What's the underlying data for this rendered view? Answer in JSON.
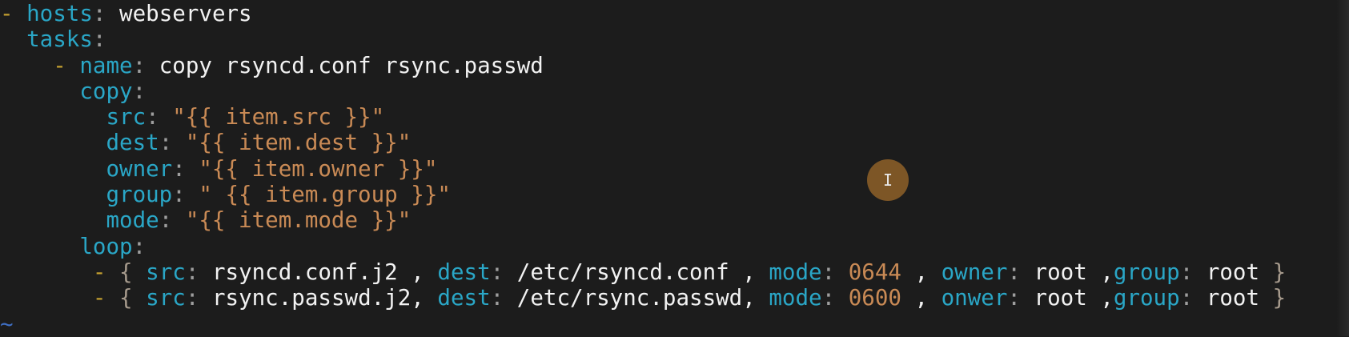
{
  "editor": {
    "lines": [
      [
        {
          "t": "- ",
          "c": "dash"
        },
        {
          "t": "hosts",
          "c": "key"
        },
        {
          "t": ": ",
          "c": "colon"
        },
        {
          "t": "webservers",
          "c": "plain"
        }
      ],
      [
        {
          "t": "  ",
          "c": "plain"
        },
        {
          "t": "tasks",
          "c": "key"
        },
        {
          "t": ":",
          "c": "colon"
        }
      ],
      [
        {
          "t": "    ",
          "c": "plain"
        },
        {
          "t": "- ",
          "c": "dash"
        },
        {
          "t": "name",
          "c": "key"
        },
        {
          "t": ": ",
          "c": "colon"
        },
        {
          "t": "copy rsyncd.conf rsync.passwd",
          "c": "plain"
        }
      ],
      [
        {
          "t": "      ",
          "c": "plain"
        },
        {
          "t": "copy",
          "c": "key"
        },
        {
          "t": ":",
          "c": "colon"
        }
      ],
      [
        {
          "t": "        ",
          "c": "plain"
        },
        {
          "t": "src",
          "c": "key"
        },
        {
          "t": ": ",
          "c": "colon"
        },
        {
          "t": "\"{{ item.src }}\"",
          "c": "str"
        }
      ],
      [
        {
          "t": "        ",
          "c": "plain"
        },
        {
          "t": "dest",
          "c": "key"
        },
        {
          "t": ": ",
          "c": "colon"
        },
        {
          "t": "\"{{ item.dest }}\"",
          "c": "str"
        }
      ],
      [
        {
          "t": "        ",
          "c": "plain"
        },
        {
          "t": "owner",
          "c": "key"
        },
        {
          "t": ": ",
          "c": "colon"
        },
        {
          "t": "\"{{ item.owner }}\"",
          "c": "str"
        }
      ],
      [
        {
          "t": "        ",
          "c": "plain"
        },
        {
          "t": "group",
          "c": "key"
        },
        {
          "t": ": ",
          "c": "colon"
        },
        {
          "t": "\" {{ item.group }}\"",
          "c": "str"
        }
      ],
      [
        {
          "t": "        ",
          "c": "plain"
        },
        {
          "t": "mode",
          "c": "key"
        },
        {
          "t": ": ",
          "c": "colon"
        },
        {
          "t": "\"{{ item.mode }}\"",
          "c": "str"
        }
      ],
      [
        {
          "t": "      ",
          "c": "plain"
        },
        {
          "t": "loop",
          "c": "key"
        },
        {
          "t": ":",
          "c": "colon"
        }
      ],
      [
        {
          "t": "       ",
          "c": "plain"
        },
        {
          "t": "- ",
          "c": "dash"
        },
        {
          "t": "{ ",
          "c": "brace"
        },
        {
          "t": "src",
          "c": "key"
        },
        {
          "t": ": ",
          "c": "colon"
        },
        {
          "t": "rsyncd.conf.j2 , ",
          "c": "plain"
        },
        {
          "t": "dest",
          "c": "key"
        },
        {
          "t": ": ",
          "c": "colon"
        },
        {
          "t": "/etc/rsyncd.conf , ",
          "c": "plain"
        },
        {
          "t": "mode",
          "c": "key"
        },
        {
          "t": ": ",
          "c": "colon"
        },
        {
          "t": "0644",
          "c": "num"
        },
        {
          "t": " , ",
          "c": "plain"
        },
        {
          "t": "owner",
          "c": "key"
        },
        {
          "t": ": ",
          "c": "colon"
        },
        {
          "t": "root ,",
          "c": "plain"
        },
        {
          "t": "group",
          "c": "key"
        },
        {
          "t": ": ",
          "c": "colon"
        },
        {
          "t": "root ",
          "c": "plain"
        },
        {
          "t": "}",
          "c": "brace"
        }
      ],
      [
        {
          "t": "       ",
          "c": "plain"
        },
        {
          "t": "- ",
          "c": "dash"
        },
        {
          "t": "{ ",
          "c": "brace"
        },
        {
          "t": "src",
          "c": "key"
        },
        {
          "t": ": ",
          "c": "colon"
        },
        {
          "t": "rsync.passwd.j2, ",
          "c": "plain"
        },
        {
          "t": "dest",
          "c": "key"
        },
        {
          "t": ": ",
          "c": "colon"
        },
        {
          "t": "/etc/rsync.passwd, ",
          "c": "plain"
        },
        {
          "t": "mode",
          "c": "key"
        },
        {
          "t": ": ",
          "c": "colon"
        },
        {
          "t": "0600",
          "c": "num"
        },
        {
          "t": " , ",
          "c": "plain"
        },
        {
          "t": "onwer",
          "c": "key"
        },
        {
          "t": ": ",
          "c": "colon"
        },
        {
          "t": "root ,",
          "c": "plain"
        },
        {
          "t": "group",
          "c": "key"
        },
        {
          "t": ": ",
          "c": "colon"
        },
        {
          "t": "root ",
          "c": "plain"
        },
        {
          "t": "}",
          "c": "brace"
        }
      ],
      [
        {
          "t": "~",
          "c": "tilde"
        }
      ]
    ]
  },
  "colors": {
    "background": "#1c1c1c",
    "key": "#2aa6c6",
    "string": "#c98a55",
    "dash": "#c5a030",
    "text": "#f2f2f2",
    "tilde": "#3f6fc4",
    "cursor_highlight": "#7d5626"
  },
  "cursor": {
    "icon": "text-cursor-ibeam-icon",
    "glyph": "I"
  }
}
